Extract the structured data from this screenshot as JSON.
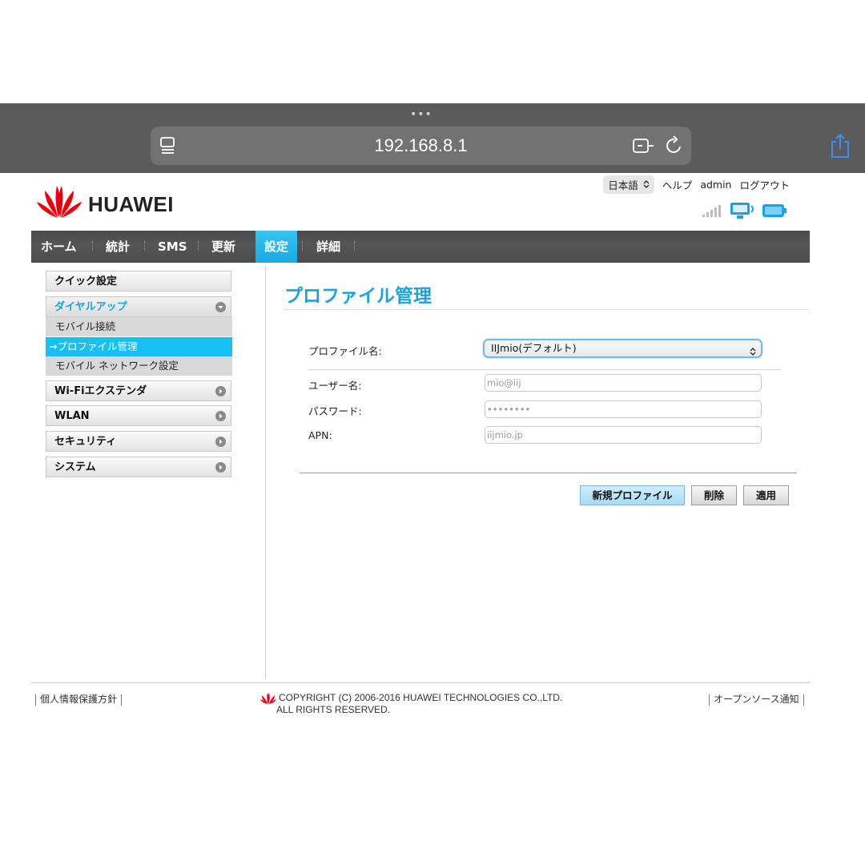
{
  "browser": {
    "url": "192.168.8.1",
    "tab_dots": "•••"
  },
  "header": {
    "brand": "HUAWEI",
    "language": "日本語",
    "help": "ヘルプ",
    "user": "admin",
    "logout": "ログアウト"
  },
  "nav": {
    "items": [
      "ホーム",
      "統計",
      "SMS",
      "更新",
      "設定",
      "詳細"
    ],
    "active": "設定"
  },
  "sidebar": {
    "quick": "クイック設定",
    "dialup": "ダイヤルアップ",
    "sub_items": [
      "モバイル接続",
      "→プロファイル管理",
      "モバイル ネットワーク設定"
    ],
    "wifi_extender": "Wi-Fiエクステンダ",
    "wlan": "WLAN",
    "security": "セキュリティ",
    "system": "システム"
  },
  "main": {
    "title": "プロファイル管理",
    "profile_label": "プロファイル名:",
    "profile_value": "IIJmio(デフォルト)",
    "username_label": "ユーザー名:",
    "username_value": "mio@iij",
    "password_label": "パスワード:",
    "password_value": "••••••••",
    "apn_label": "APN:",
    "apn_value": "iijmio.jp",
    "btn_new": "新規プロファイル",
    "btn_delete": "削除",
    "btn_apply": "適用"
  },
  "footer": {
    "privacy": "個人情報保護方針",
    "copyright_line1": "COPYRIGHT (C) 2006-2016 HUAWEI TECHNOLOGIES CO.,LTD.",
    "copyright_line2": "ALL RIGHTS RESERVED.",
    "open_source": "オープンソース通知"
  },
  "colors": {
    "accent": "#1ea3d8",
    "nav_active": "#29b8ea",
    "brand_red": "#e60012"
  }
}
